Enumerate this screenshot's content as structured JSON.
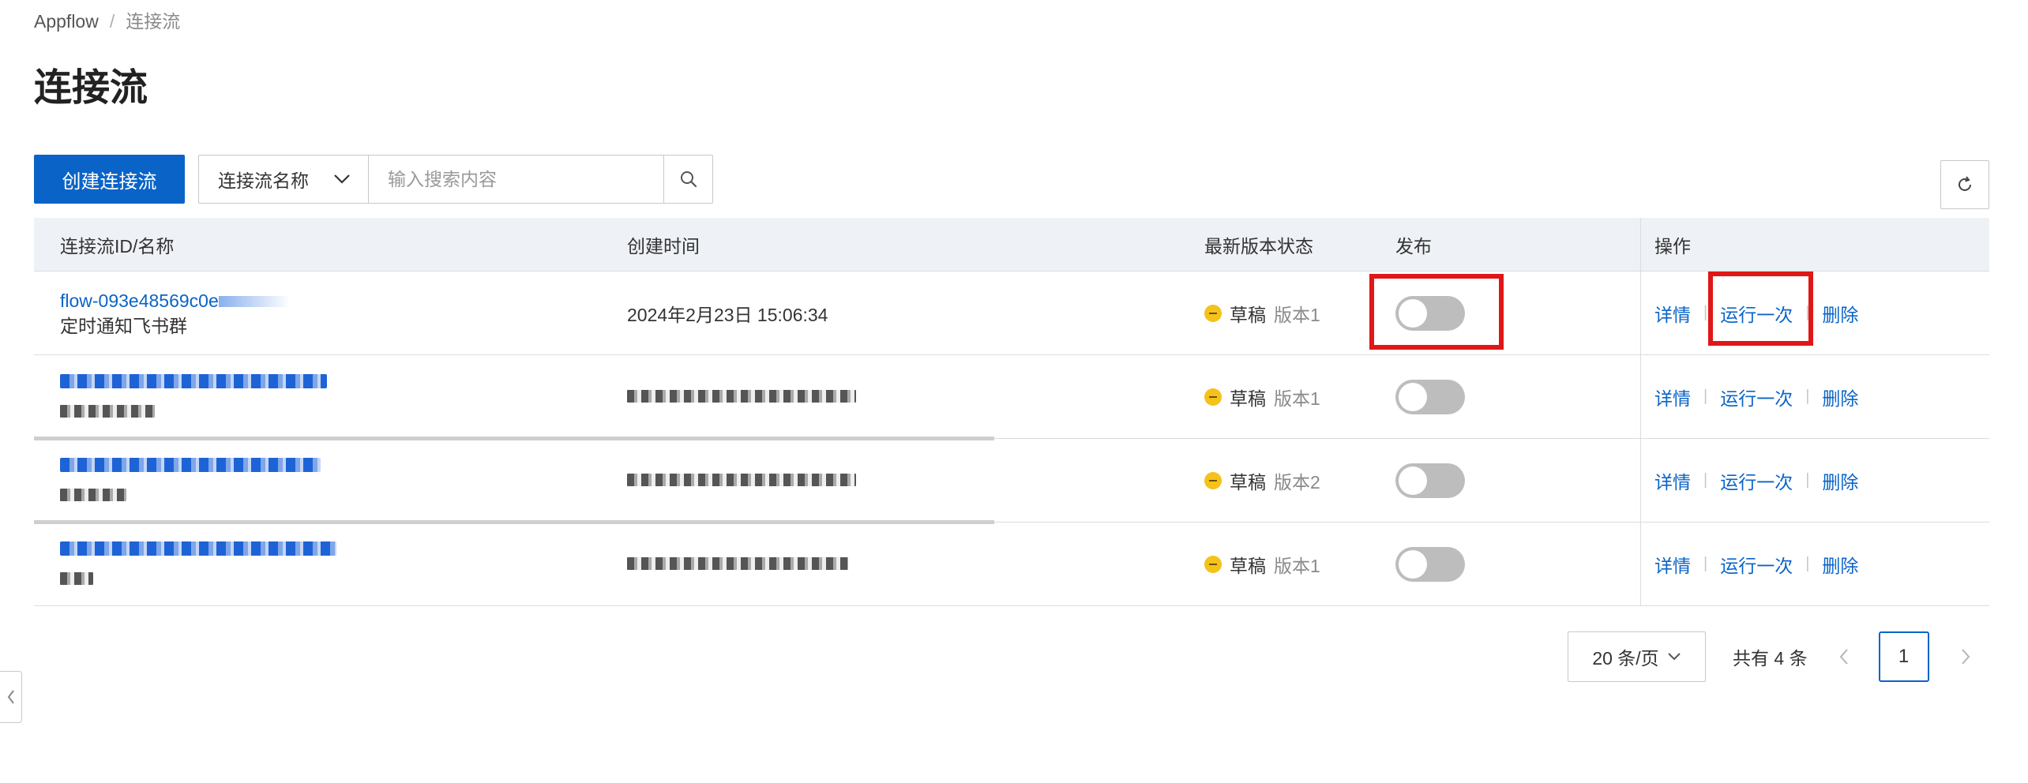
{
  "breadcrumb": {
    "root": "Appflow",
    "separator": "/",
    "current": "连接流"
  },
  "page_title": "连接流",
  "toolbar": {
    "create_label": "创建连接流",
    "filter_select": "连接流名称",
    "search_placeholder": "输入搜索内容"
  },
  "table": {
    "headers": {
      "id_name": "连接流ID/名称",
      "created": "创建时间",
      "status": "最新版本状态",
      "publish": "发布",
      "ops": "操作"
    },
    "ops_labels": {
      "detail": "详情",
      "run_once": "运行一次",
      "delete": "删除",
      "sep": "|"
    },
    "rows": [
      {
        "flow_id": "flow-093e48569c0e",
        "name": "定时通知飞书群",
        "created": "2024年2月23日 15:06:34",
        "status": "草稿",
        "version": "版本1",
        "published": false
      },
      {
        "flow_id": "",
        "name": "",
        "created": "",
        "status": "草稿",
        "version": "版本1",
        "published": false
      },
      {
        "flow_id": "",
        "name": "",
        "created": "",
        "status": "草稿",
        "version": "版本2",
        "published": false
      },
      {
        "flow_id": "",
        "name": "",
        "created": "",
        "status": "草稿",
        "version": "版本1",
        "published": false
      }
    ]
  },
  "pagination": {
    "page_size": "20 条/页",
    "total": "共有 4 条",
    "current_page": "1"
  },
  "colors": {
    "primary": "#0a64c7",
    "draft_status": "#f5c21b",
    "highlight": "#e01717"
  }
}
